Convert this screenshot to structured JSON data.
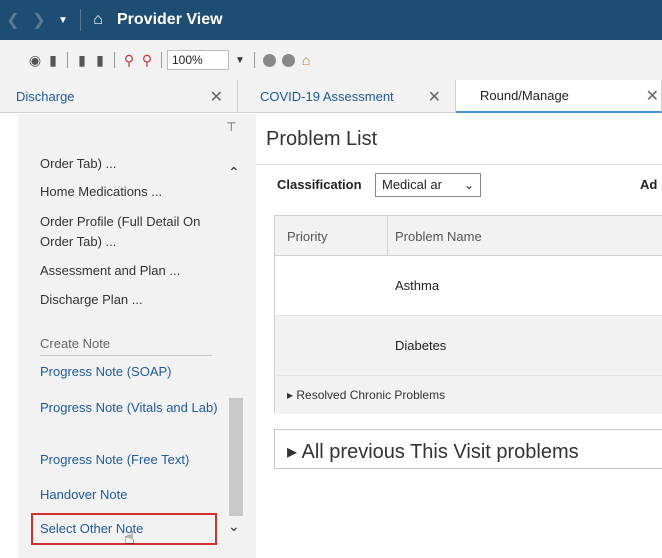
{
  "titlebar": {
    "back_icon": "back-arrow",
    "forward_icon": "forward-arrow",
    "title": "Provider View"
  },
  "toolbar": {
    "zoom": "100%"
  },
  "tabs": [
    {
      "label": "Discharge"
    },
    {
      "label": "COVID-19 Assessment"
    },
    {
      "label": "Round/Manage"
    }
  ],
  "left_nav": {
    "items": [
      "Order Tab) ...",
      "Home Medications ...",
      "Order Profile (Full Detail On Order Tab) ...",
      "Assessment and Plan ...",
      "Discharge Plan ..."
    ],
    "create_note_header": "Create Note",
    "note_links": [
      "Progress Note (SOAP)",
      "Progress Note (Vitals and Lab)",
      "Progress Note (Free Text)",
      "Handover Note",
      "Select Other Note"
    ],
    "highlight_color": "#d32f2f"
  },
  "problem_list": {
    "title": "Problem List",
    "classification_label": "Classification",
    "classification_value": "Medical ar",
    "add_label": "Ad",
    "columns": [
      "Priority",
      "Problem Name"
    ],
    "rows": [
      {
        "priority": "",
        "name": "Asthma"
      },
      {
        "priority": "",
        "name": "Diabetes"
      }
    ],
    "resolved_group": "Resolved Chronic Problems",
    "previous_section": "All previous This Visit problems"
  }
}
